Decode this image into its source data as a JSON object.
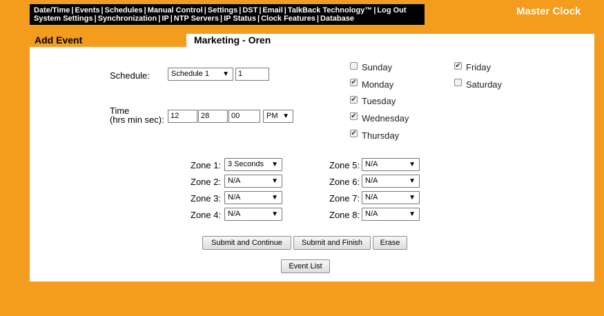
{
  "nav": {
    "row1": [
      "Date/Time",
      "Events",
      "Schedules",
      "Manual Control",
      "Settings",
      "DST",
      "Email",
      "TalkBack Technology™",
      "Log Out"
    ],
    "row2": [
      "System Settings",
      "Synchronization",
      "IP",
      "NTP Servers",
      "IP Status",
      "Clock Features",
      "Database"
    ]
  },
  "brand": "Master Clock",
  "page_title": "Add Event",
  "section_title": "Marketing - Oren",
  "form": {
    "schedule_label": "Schedule:",
    "schedule_select": "Schedule 1",
    "schedule_value": "1",
    "time_label_1": "Time",
    "time_label_2": "(hrs min sec):",
    "hours": "12",
    "minutes": "28",
    "seconds": "00",
    "ampm": "PM"
  },
  "days": {
    "sunday": {
      "label": "Sunday",
      "checked": false
    },
    "monday": {
      "label": "Monday",
      "checked": true
    },
    "tuesday": {
      "label": "Tuesday",
      "checked": true
    },
    "wednesday": {
      "label": "Wednesday",
      "checked": true
    },
    "thursday": {
      "label": "Thursday",
      "checked": true
    },
    "friday": {
      "label": "Friday",
      "checked": true
    },
    "saturday": {
      "label": "Saturday",
      "checked": false
    }
  },
  "zones": [
    {
      "label": "Zone 1:",
      "value": "3 Seconds"
    },
    {
      "label": "Zone 2:",
      "value": "N/A"
    },
    {
      "label": "Zone 3:",
      "value": "N/A"
    },
    {
      "label": "Zone 4:",
      "value": "N/A"
    },
    {
      "label": "Zone 5:",
      "value": "N/A"
    },
    {
      "label": "Zone 6:",
      "value": "N/A"
    },
    {
      "label": "Zone 7:",
      "value": "N/A"
    },
    {
      "label": "Zone 8:",
      "value": "N/A"
    }
  ],
  "buttons": {
    "submit_continue": "Submit and Continue",
    "submit_finish": "Submit and Finish",
    "erase": "Erase",
    "event_list": "Event List"
  },
  "colors": {
    "background": "#f39c1e",
    "nav_bg": "#000000",
    "panel": "#ffffff"
  }
}
